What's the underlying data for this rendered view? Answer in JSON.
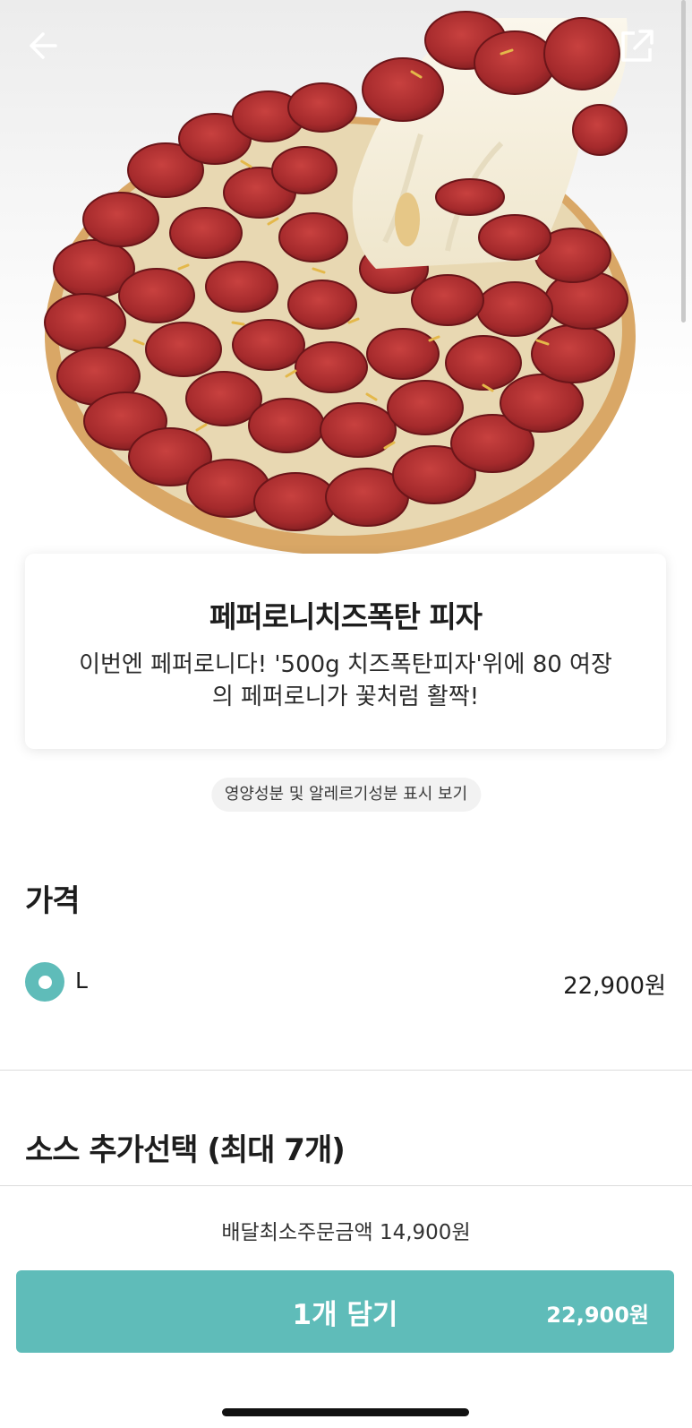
{
  "header": {
    "back_icon": "arrow-left-icon",
    "share_icon": "share-external-icon"
  },
  "product": {
    "image_alt": "pepperoni pizza photo",
    "title": "페퍼로니치즈폭탄 피자",
    "description": "이번엔 페퍼로니다! '500g 치즈폭탄피자'위에 80 여장의 페퍼로니가 꽃처럼 활짝!",
    "nutrition_link": "영양성분 및 알레르기성분 표시 보기"
  },
  "price_section": {
    "title": "가격",
    "options": [
      {
        "label": "L",
        "price": "22,900원",
        "selected": true
      }
    ]
  },
  "sauce_section": {
    "title": "소스 추가선택 (최대 7개)"
  },
  "footer": {
    "min_order": "배달최소주문금액 14,900원",
    "cart_button_label": "1개 담기",
    "cart_button_price": "22,900원"
  },
  "colors": {
    "accent": "#5fbcb9",
    "text": "#1d1d1d"
  }
}
